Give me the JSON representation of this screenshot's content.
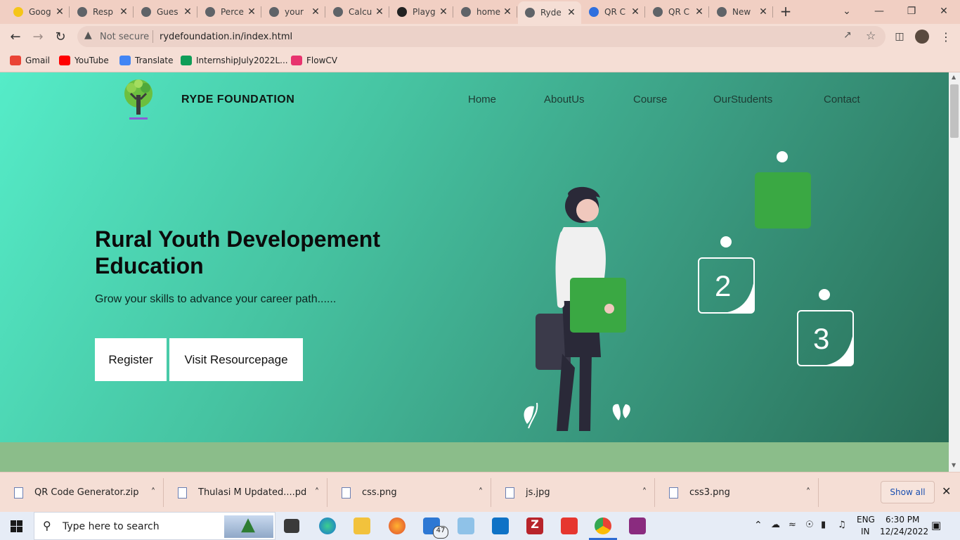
{
  "tabs": [
    {
      "title": "Goog",
      "icon": "lightbulb-icon",
      "color": "#f5c518"
    },
    {
      "title": "Resp",
      "icon": "globe-icon",
      "color": "#5f6368"
    },
    {
      "title": "Gues",
      "icon": "globe-icon",
      "color": "#5f6368"
    },
    {
      "title": "Perce",
      "icon": "globe-icon",
      "color": "#5f6368"
    },
    {
      "title": "your",
      "icon": "globe-icon",
      "color": "#5f6368"
    },
    {
      "title": "Calcu",
      "icon": "globe-icon",
      "color": "#5f6368"
    },
    {
      "title": "Playg",
      "icon": "openai-icon",
      "color": "#222222"
    },
    {
      "title": "home",
      "icon": "globe-icon",
      "color": "#5f6368"
    },
    {
      "title": "Ryde",
      "icon": "globe-icon",
      "color": "#5f6368",
      "active": true
    },
    {
      "title": "QR C",
      "icon": "cn-icon",
      "color": "#2f6fde"
    },
    {
      "title": "QR C",
      "icon": "globe-icon",
      "color": "#5f6368"
    },
    {
      "title": "New",
      "icon": "chrome-icon",
      "color": "#5f6368"
    }
  ],
  "address": {
    "security": "Not secure",
    "url": "rydefoundation.in/index.html"
  },
  "bookmarks": [
    {
      "label": "Gmail",
      "icon": "gmail-icon",
      "color": "#ea4335"
    },
    {
      "label": "YouTube",
      "icon": "youtube-icon",
      "color": "#ff0000"
    },
    {
      "label": "Translate",
      "icon": "translate-icon",
      "color": "#4285f4"
    },
    {
      "label": "InternshipJuly2022L...",
      "icon": "sheets-icon",
      "color": "#0f9d58"
    },
    {
      "label": "FlowCV",
      "icon": "flowcv-icon",
      "color": "#e8336e"
    }
  ],
  "site": {
    "brand": "RYDE FOUNDATION",
    "nav": [
      "Home",
      "AboutUs",
      "Course",
      "OurStudents",
      "Contact"
    ],
    "hero_title": "Rural Youth Developement Education",
    "hero_subtitle": "Grow your skills to advance your career path......",
    "buttons": {
      "register": "Register",
      "resources": "Visit Resourcepage"
    },
    "cards": [
      "2",
      "3"
    ]
  },
  "downloads": {
    "items": [
      {
        "name": "QR Code Generator.zip",
        "icon": "zip-icon"
      },
      {
        "name": "Thulasi M Updated....pdf",
        "icon": "pdf-icon"
      },
      {
        "name": "css.png",
        "icon": "image-file-icon"
      },
      {
        "name": "js.jpg",
        "icon": "image-file-icon"
      },
      {
        "name": "css3.png",
        "icon": "image-file-icon"
      }
    ],
    "show_all": "Show all"
  },
  "taskbar": {
    "search_placeholder": "Type here to search",
    "mail_badge": "47",
    "language": "ENG",
    "region": "IN",
    "time": "6:30 PM",
    "date": "12/24/2022"
  }
}
